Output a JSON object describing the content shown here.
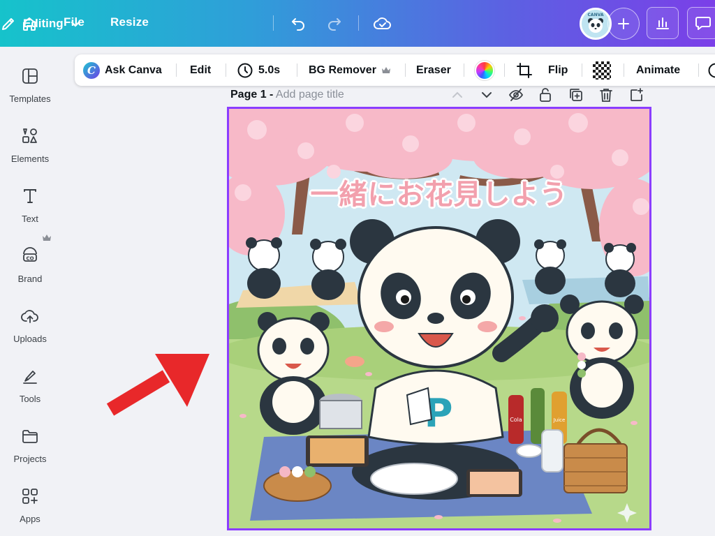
{
  "header": {
    "file_label": "File",
    "resize_label": "Resize",
    "editing_label": "Editing",
    "avatar_text": "CANVA"
  },
  "sidebar": {
    "items": [
      {
        "label": "Templates",
        "icon": "templates-icon"
      },
      {
        "label": "Elements",
        "icon": "elements-icon"
      },
      {
        "label": "Text",
        "icon": "text-icon"
      },
      {
        "label": "Brand",
        "icon": "brand-icon"
      },
      {
        "label": "Uploads",
        "icon": "uploads-icon"
      },
      {
        "label": "Tools",
        "icon": "tools-icon"
      },
      {
        "label": "Projects",
        "icon": "projects-icon"
      },
      {
        "label": "Apps",
        "icon": "apps-icon"
      }
    ]
  },
  "context_toolbar": {
    "ask_canva": "Ask Canva",
    "logo_letter": "C",
    "edit": "Edit",
    "duration": "5.0s",
    "bg_remover": "BG Remover",
    "eraser": "Eraser",
    "flip": "Flip",
    "animate": "Animate"
  },
  "page": {
    "number_label": "Page 1 -",
    "title_placeholder": "Add page title"
  },
  "canvas": {
    "headline": "一緒にお花見しよう",
    "shirt_letter": "P",
    "bottle_labels": [
      "Cola",
      "Juice"
    ]
  },
  "colors": {
    "accent": "#8b3dff",
    "arrow": "#e8282a",
    "header_start": "#16c3cb",
    "header_end": "#7b3fe8"
  }
}
